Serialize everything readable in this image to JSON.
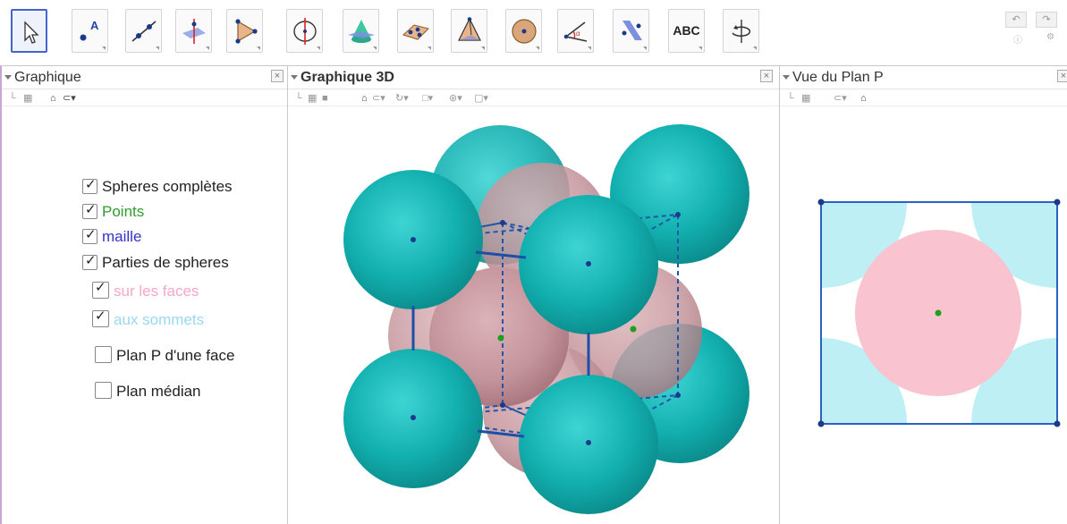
{
  "toolbar": {
    "tools": [
      {
        "name": "move-tool",
        "icon": "arrow-pointer-icon"
      },
      {
        "name": "point-tool",
        "icon": "point-A-icon",
        "label_glyph": "A"
      },
      {
        "name": "line-tool",
        "icon": "line-through-points-icon"
      },
      {
        "name": "perpendicular-tool",
        "icon": "perpendicular-plane-icon"
      },
      {
        "name": "polygon-tool",
        "icon": "triangle-polygon-icon"
      },
      {
        "name": "rotate-axis-tool",
        "icon": "circle-axis-icon"
      },
      {
        "name": "intersect-tool",
        "icon": "cone-plane-icon"
      },
      {
        "name": "plane-tool",
        "icon": "plane-points-icon"
      },
      {
        "name": "pyramid-tool",
        "icon": "pyramid-icon"
      },
      {
        "name": "sphere-tool",
        "icon": "sphere-center-icon"
      },
      {
        "name": "angle-tool",
        "icon": "angle-icon"
      },
      {
        "name": "reflect-tool",
        "icon": "reflect-plane-icon"
      },
      {
        "name": "text-tool",
        "icon": "text-icon",
        "label": "ABC"
      },
      {
        "name": "rotate-view-tool",
        "icon": "rotate-view-icon"
      }
    ],
    "undo_icon": "undo-icon",
    "redo_icon": "redo-icon"
  },
  "panels": {
    "graphique": {
      "title": "Graphique"
    },
    "graphique3d": {
      "title": "Graphique 3D"
    },
    "plan": {
      "title": "Vue du Plan P"
    }
  },
  "checkboxes": [
    {
      "label": "Spheres complètes",
      "checked": true,
      "color": "#222222"
    },
    {
      "label": "Points",
      "checked": true,
      "color": "#2e9e2e"
    },
    {
      "label": "maille",
      "checked": true,
      "color": "#3333cc"
    },
    {
      "label": "Parties de spheres",
      "checked": true,
      "color": "#222222"
    },
    {
      "label": "sur les faces",
      "checked": true,
      "color": "#f6a6c8"
    },
    {
      "label": "aux sommets",
      "checked": true,
      "color": "#9ad8f0"
    },
    {
      "label": "Plan P d'une face",
      "checked": false,
      "color": "#222222"
    },
    {
      "label": "Plan médian",
      "checked": false,
      "color": "#222222"
    }
  ],
  "colors": {
    "teal_sphere": "#14b2b2",
    "pink_sphere": "#c89aa2",
    "cube_edge": "#2255aa",
    "face_disc": "#f9c4cf",
    "corner_disc": "#bdeff5",
    "point": "#1f9e1f"
  }
}
